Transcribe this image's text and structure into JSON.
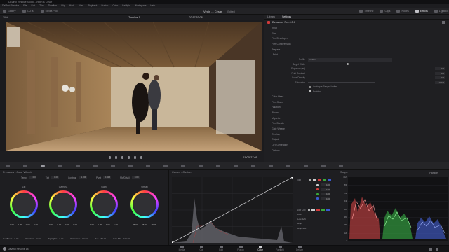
{
  "app": {
    "title": "DaVinci Resolve Studio - Virgin & César"
  },
  "menu": [
    "DaVinci Resolve",
    "File",
    "Edit",
    "Trim",
    "Timeline",
    "Clip",
    "Mark",
    "View",
    "Playback",
    "Fusion",
    "Color",
    "Fairlight",
    "Workspace",
    "Help"
  ],
  "topbar": {
    "left": [
      "Gallery",
      "LUTs",
      "Media Pool"
    ],
    "center_timeline": "Timeline 1",
    "project": "Virgin ... César",
    "edited": "Edited",
    "timecode_top": "02:57:53:08",
    "right": [
      "Timeline",
      "Clips",
      "Nodes",
      "Effects",
      "Lightbox"
    ]
  },
  "viewer": {
    "zoom": "39%",
    "timecode": "01:00:27:05"
  },
  "inspector": {
    "tabs": [
      "Library",
      "Settings"
    ],
    "active_tab": "Settings",
    "effect_name": "Dehancer Pro 4.3.0",
    "sections_a": [
      "Input",
      "Film",
      "Film Developer",
      "Film Compression",
      "Prepare",
      "Print"
    ],
    "params": [
      {
        "label": "Profile",
        "value": "Cineon"
      },
      {
        "label": "Target White",
        "value": ""
      },
      {
        "label": "Exposure (ev)",
        "value": "0.0"
      },
      {
        "label": "Print Contrast",
        "value": "0.0"
      },
      {
        "label": "Color Density",
        "value": "0.0"
      },
      {
        "label": "Saturation",
        "value": "100.0"
      }
    ],
    "checks": [
      "Analogue Range Limiter",
      "Enabled"
    ],
    "sections_b": [
      "Color Head",
      "Film Grain",
      "Halation",
      "Bloom",
      "Vignette",
      "Film Breath",
      "Gate Weave",
      "Overlay",
      "Output",
      "LUT Generator",
      "Options"
    ]
  },
  "wheels": {
    "title": "Primaries - Color Wheels",
    "controls": [
      {
        "label": "Temp",
        "value": "0.0"
      },
      {
        "label": "Tint",
        "value": "0.00"
      },
      {
        "label": "Contrast",
        "value": "1.000"
      },
      {
        "label": "Pivot",
        "value": "0.435"
      },
      {
        "label": "Md/Detail",
        "value": "0.00"
      }
    ],
    "items": [
      {
        "name": "Lift",
        "values": [
          "0.00",
          "0.00",
          "0.00",
          "0.00"
        ]
      },
      {
        "name": "Gamma",
        "values": [
          "0.00",
          "0.00",
          "0.00",
          "0.00"
        ]
      },
      {
        "name": "Gain",
        "values": [
          "1.00",
          "1.00",
          "1.00",
          "1.00"
        ]
      },
      {
        "name": "Offset",
        "values": [
          "25.00",
          "25.00",
          "25.00"
        ]
      }
    ],
    "bottom": [
      {
        "label": "Col Boost",
        "value": "0.00"
      },
      {
        "label": "Shadows",
        "value": "0.00"
      },
      {
        "label": "Highlights",
        "value": "0.00"
      },
      {
        "label": "Saturation",
        "value": "50.00"
      },
      {
        "label": "Hue",
        "value": "50.00"
      },
      {
        "label": "Lum Mix",
        "value": "100.00"
      }
    ]
  },
  "curves": {
    "title": "Curves - Custom",
    "edit": "Edit",
    "softclip": "Soft Clip",
    "channel_vals": [
      "100",
      "100",
      "100",
      "100"
    ],
    "softclip_labels": [
      "Low",
      "Low Soft",
      "High",
      "High Soft"
    ],
    "colors": {
      "red": "#d33a3a",
      "green": "#3aa83a",
      "blue": "#3a5ad3",
      "white": "#cccccc"
    }
  },
  "scopes": {
    "title": "Scope",
    "mode": "Parade",
    "ticks": [
      "1023",
      "896",
      "768",
      "640",
      "512",
      "384",
      "256",
      "128",
      "0"
    ]
  },
  "pages": [
    "Media",
    "Cut",
    "Edit",
    "Fusion",
    "Color",
    "Fairlight",
    "Deliver"
  ],
  "active_page": "Color",
  "status": "DaVinci Resolve 18"
}
